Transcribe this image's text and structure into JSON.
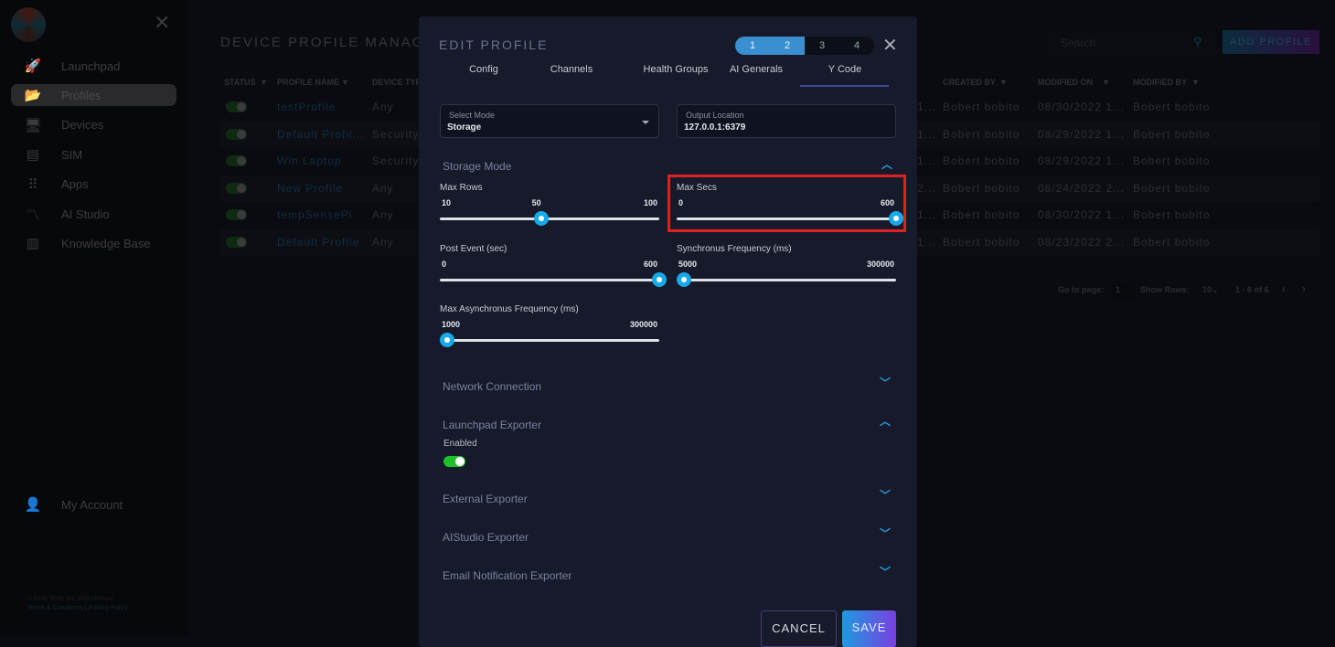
{
  "sidebar": {
    "items": [
      {
        "label": "Launchpad",
        "icon": "rocket-icon"
      },
      {
        "label": "Profiles",
        "icon": "folder-icon",
        "active": true
      },
      {
        "label": "Devices",
        "icon": "monitor-icon"
      },
      {
        "label": "SIM",
        "icon": "sim-icon"
      },
      {
        "label": "Apps",
        "icon": "grid-icon"
      },
      {
        "label": "AI Studio",
        "icon": "ai-studio-icon"
      },
      {
        "label": "Knowledge Base",
        "icon": "books-icon"
      }
    ],
    "account": "My Account",
    "copyright": "© ONE Tech, Inc DBA MicroAI",
    "terms": "Terms & Conditions",
    "privacy": "Privacy Policy",
    "sep": "|"
  },
  "page": {
    "title": "DEVICE PROFILE MANAGEM",
    "search_placeholder": "Search",
    "add_button": "ADD PROFILE"
  },
  "table": {
    "headers_left": [
      "STATUS",
      "PROFILE NAME",
      "DEVICE TYP"
    ],
    "headers_right": [
      "CREATED BY",
      "MODIFIED ON",
      "MODIFIED BY"
    ],
    "rows": [
      {
        "name": "testProfile",
        "type": "Any",
        "trunc": "1...",
        "created_by": "Bobert bobito",
        "modified_on": "08/30/2022 1...",
        "modified_by": "Bobert bobito"
      },
      {
        "name": "Default Profil...",
        "type": "Security",
        "trunc": "1...",
        "created_by": "Bobert bobito",
        "modified_on": "08/29/2022 1...",
        "modified_by": "Bobert bobito"
      },
      {
        "name": "Win Laptop",
        "type": "Security",
        "trunc": "1...",
        "created_by": "Bobert bobito",
        "modified_on": "08/29/2022 1...",
        "modified_by": "Bobert bobito"
      },
      {
        "name": "New Profile",
        "type": "Any",
        "trunc": "2...",
        "created_by": "Bobert bobito",
        "modified_on": "08/24/2022 2...",
        "modified_by": "Bobert bobito"
      },
      {
        "name": "tempSensePi",
        "type": "Any",
        "trunc": "1...",
        "created_by": "Bobert bobito",
        "modified_on": "08/30/2022 1...",
        "modified_by": "Bobert bobito"
      },
      {
        "name": "Default Profile",
        "type": "Any",
        "trunc": "1...",
        "created_by": "Bobert bobito",
        "modified_on": "08/23/2022 2...",
        "modified_by": "Bobert bobito"
      }
    ]
  },
  "pagination": {
    "goto_label": "Go to page:",
    "page": "1",
    "rows_label": "Show Rows:",
    "rows": "10",
    "range": "1 - 6 of 6"
  },
  "modal": {
    "title": "EDIT PROFILE",
    "steps": [
      "1",
      "2",
      "3",
      "4"
    ],
    "active_steps": 2,
    "tabs": [
      "Config",
      "Channels",
      "Health Groups",
      "AI Generals",
      "Y Code"
    ],
    "active_tab": "Y Code",
    "select_mode": {
      "label": "Select Mode",
      "value": "Storage"
    },
    "output_location": {
      "label": "Output Location",
      "value": "127.0.0.1:6379"
    },
    "storage_section": "Storage Mode",
    "sliders": [
      {
        "label": "Max Rows",
        "min": "10",
        "max": "100",
        "value": 50,
        "value_label": "50",
        "minv": 10,
        "maxv": 100
      },
      {
        "label": "Max Secs",
        "min": "0",
        "max": "600",
        "value": 600,
        "minv": 0,
        "maxv": 600,
        "highlighted": true
      },
      {
        "label": "Post Event (sec)",
        "min": "0",
        "max": "600",
        "value": 600,
        "minv": 0,
        "maxv": 600
      },
      {
        "label": "Synchronus Frequency (ms)",
        "min": "5000",
        "max": "300000",
        "value": 5000,
        "minv": 5000,
        "maxv": 300000
      },
      {
        "label": "Max Asynchronus Frequency (ms)",
        "min": "1000",
        "max": "300000",
        "value": 1000,
        "minv": 1000,
        "maxv": 300000
      }
    ],
    "sections": [
      "Network Connection",
      "Launchpad Exporter",
      "External Exporter",
      "AIStudio Exporter",
      "Email Notification Exporter"
    ],
    "enabled_label": "Enabled",
    "enabled": true,
    "cancel": "CANCEL",
    "save": "SAVE"
  }
}
